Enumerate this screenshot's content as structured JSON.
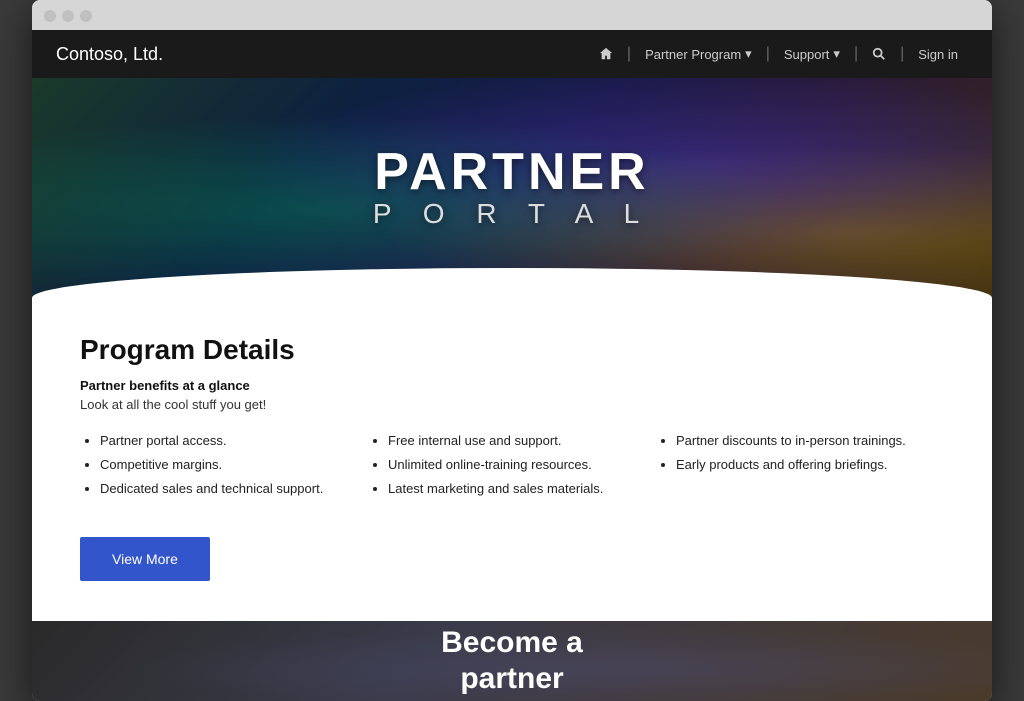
{
  "browser": {
    "dots": [
      "dot1",
      "dot2",
      "dot3"
    ]
  },
  "navbar": {
    "brand": "Contoso, Ltd.",
    "home_label": "",
    "partner_program_label": "Partner Program",
    "support_label": "Support",
    "signin_label": "Sign in"
  },
  "hero": {
    "partner_text": "PARTNER",
    "portal_text": "P O R T A L"
  },
  "program_details": {
    "title": "Program Details",
    "subtitle": "Partner benefits at a glance",
    "description": "Look at all the cool stuff you get!",
    "col1_items": [
      "Partner portal access.",
      "Competitive margins.",
      "Dedicated sales and technical support."
    ],
    "col2_items": [
      "Free internal use and support.",
      "Unlimited online-training resources.",
      "Latest marketing and sales materials."
    ],
    "col3_items": [
      "Partner discounts to in-person trainings.",
      "Early products and offering briefings."
    ],
    "view_more_label": "View More"
  },
  "bottom": {
    "become_line1": "Become a",
    "become_line2": "partner"
  }
}
